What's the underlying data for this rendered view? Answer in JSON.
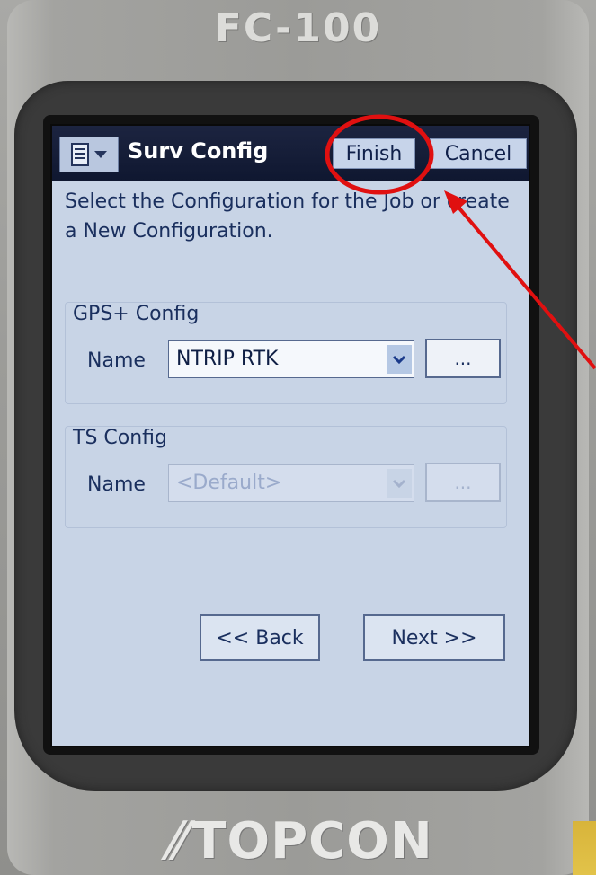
{
  "device": {
    "model": "FC-100",
    "brand": "TOPCON"
  },
  "titlebar": {
    "menu_icon": "menu-icon",
    "title": "Surv Config",
    "finish_label": "Finish",
    "cancel_label": "Cancel"
  },
  "instruction": "Select the Configuration for the Job or create a New Configuration.",
  "gps_config": {
    "group_title": "GPS+ Config",
    "name_label": "Name",
    "selected": "NTRIP RTK",
    "ellipsis_label": "..."
  },
  "ts_config": {
    "group_title": "TS Config",
    "name_label": "Name",
    "selected": "<Default>",
    "ellipsis_label": "...",
    "disabled": true
  },
  "navigation": {
    "back_label": "<< Back",
    "next_label": "Next >>"
  },
  "colors": {
    "titlebar": "#0f1730",
    "screen_bg": "#c8d4e6",
    "text": "#1a2f5e",
    "annotation": "#e01010"
  }
}
